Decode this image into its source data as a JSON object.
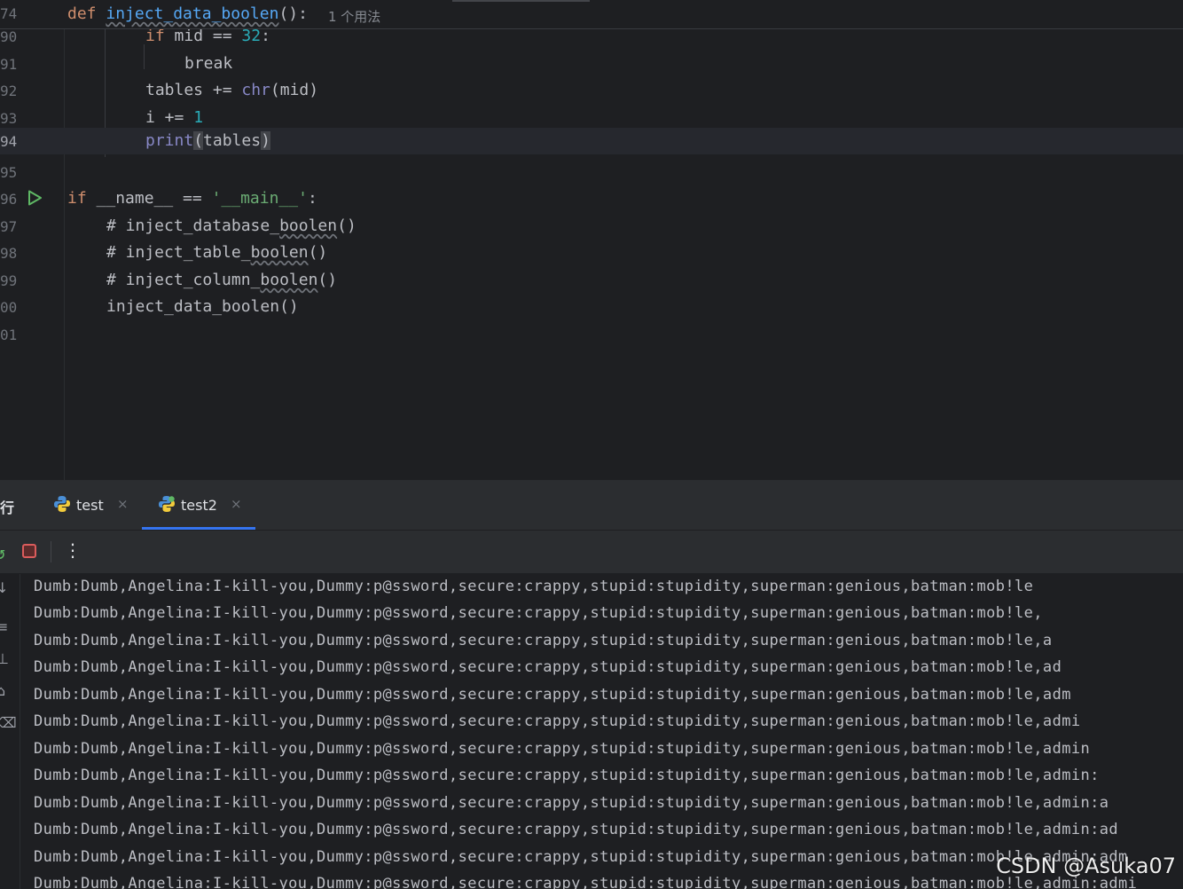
{
  "editor": {
    "sticky": {
      "line_number": "74",
      "def": "def",
      "function_name": "inject_data_boolen",
      "signature_tail": "():",
      "usage_hint": "1 个用法"
    },
    "lines": [
      {
        "n": "90",
        "parts": {
          "a": "if mid == ",
          "b": "32",
          "c": ":"
        }
      },
      {
        "n": "91",
        "parts": {
          "a": "break"
        }
      },
      {
        "n": "92",
        "parts": {
          "a": "tables += ",
          "b": "chr",
          "c": "(mid)"
        }
      },
      {
        "n": "93",
        "parts": {
          "a": "i += ",
          "b": "1"
        }
      },
      {
        "n": "94",
        "parts": {
          "a": "print",
          "b": "(",
          "c": "tables",
          "d": ")"
        }
      },
      {
        "n": "95",
        "parts": {}
      },
      {
        "n": "96",
        "parts": {
          "a": "if",
          "b": " __name__ == ",
          "c": "'__main__'",
          "d": ":"
        }
      },
      {
        "n": "97",
        "parts": {
          "a": "# inject_database_",
          "b": "boolen",
          "c": "()"
        }
      },
      {
        "n": "98",
        "parts": {
          "a": "# inject_table_",
          "b": "boolen",
          "c": "()"
        }
      },
      {
        "n": "99",
        "parts": {
          "a": "# inject_column_",
          "b": "boolen",
          "c": "()"
        }
      },
      {
        "n": "00",
        "parts": {
          "a": "inject_data_boolen()"
        }
      },
      {
        "n": "01",
        "parts": {}
      }
    ]
  },
  "run": {
    "title": "运行",
    "title_visible": "行",
    "tabs": [
      {
        "label": "test",
        "close": "×"
      },
      {
        "label": "test2",
        "close": "×"
      }
    ],
    "more_label": "⋮"
  },
  "console": {
    "side_glyphs": [
      "↓",
      "≡",
      "⊥",
      "⌂",
      "⌫"
    ],
    "prefix": "Dumb:Dumb,Angelina:I-kill-you,Dummy:p@ssword,secure:crappy,stupid:stupidity,superman:genious,batman:mob!le",
    "output": [
      "Dumb:Dumb,Angelina:I-kill-you,Dummy:p@ssword,secure:crappy,stupid:stupidity,superman:genious,batman:mob!le",
      "Dumb:Dumb,Angelina:I-kill-you,Dummy:p@ssword,secure:crappy,stupid:stupidity,superman:genious,batman:mob!le,",
      "Dumb:Dumb,Angelina:I-kill-you,Dummy:p@ssword,secure:crappy,stupid:stupidity,superman:genious,batman:mob!le,a",
      "Dumb:Dumb,Angelina:I-kill-you,Dummy:p@ssword,secure:crappy,stupid:stupidity,superman:genious,batman:mob!le,ad",
      "Dumb:Dumb,Angelina:I-kill-you,Dummy:p@ssword,secure:crappy,stupid:stupidity,superman:genious,batman:mob!le,adm",
      "Dumb:Dumb,Angelina:I-kill-you,Dummy:p@ssword,secure:crappy,stupid:stupidity,superman:genious,batman:mob!le,admi",
      "Dumb:Dumb,Angelina:I-kill-you,Dummy:p@ssword,secure:crappy,stupid:stupidity,superman:genious,batman:mob!le,admin",
      "Dumb:Dumb,Angelina:I-kill-you,Dummy:p@ssword,secure:crappy,stupid:stupidity,superman:genious,batman:mob!le,admin:",
      "Dumb:Dumb,Angelina:I-kill-you,Dummy:p@ssword,secure:crappy,stupid:stupidity,superman:genious,batman:mob!le,admin:a",
      "Dumb:Dumb,Angelina:I-kill-you,Dummy:p@ssword,secure:crappy,stupid:stupidity,superman:genious,batman:mob!le,admin:ad",
      "Dumb:Dumb,Angelina:I-kill-you,Dummy:p@ssword,secure:crappy,stupid:stupidity,superman:genious,batman:mob!le,admin:adm",
      "Dumb:Dumb,Angelina:I-kill-you,Dummy:p@ssword,secure:crappy,stupid:stupidity,superman:genious,batman:mob!le,admin:admi"
    ]
  },
  "watermark": "CSDN @Asuka07",
  "colors": {
    "background": "#1e1f22",
    "panel": "#2b2d30",
    "keyword": "#cf8e6d",
    "function": "#56a8f5",
    "number": "#2aacb8",
    "string": "#6aab73",
    "comment": "#7a7e85",
    "accent": "#3574f0",
    "run_green": "#5fb865",
    "stop_red": "#db5c5c"
  }
}
